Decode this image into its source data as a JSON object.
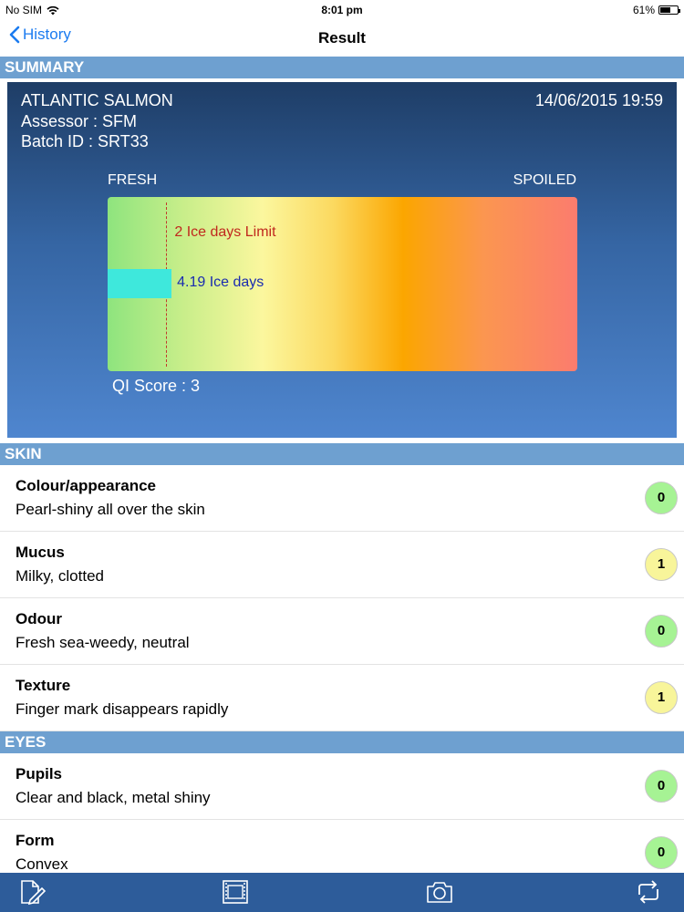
{
  "status_bar": {
    "carrier": "No SIM",
    "time": "8:01 pm",
    "battery": "61%",
    "battery_level": 0.61
  },
  "nav": {
    "back_label": "History",
    "title": "Result"
  },
  "summary": {
    "header": "SUMMARY",
    "species": "ATLANTIC SALMON",
    "datetime": "14/06/2015 19:59",
    "assessor": "Assessor : SFM",
    "batch": "Batch ID : SRT33",
    "fresh_label": "FRESH",
    "spoiled_label": "SPOILED",
    "limit_label": "2 Ice days Limit",
    "days_label": "4.19 Ice days",
    "qi_score": "QI Score : 3",
    "scale_max_ice_days": 16,
    "limit_value": 2,
    "ice_days_value": 4.19
  },
  "sections": [
    {
      "header": "SKIN",
      "rows": [
        {
          "title": "Colour/appearance",
          "value": "Pearl-shiny all over the skin",
          "score": "0",
          "color": "#a6f394"
        },
        {
          "title": "Mucus",
          "value": "Milky, clotted",
          "score": "1",
          "color": "#f8f59a"
        },
        {
          "title": "Odour",
          "value": "Fresh sea-weedy, neutral",
          "score": "0",
          "color": "#a6f394"
        },
        {
          "title": "Texture",
          "value": "Finger mark disappears rapidly",
          "score": "1",
          "color": "#f8f59a"
        }
      ]
    },
    {
      "header": "EYES",
      "rows": [
        {
          "title": "Pupils",
          "value": "Clear and black, metal shiny",
          "score": "0",
          "color": "#a6f394"
        },
        {
          "title": "Form",
          "value": "Convex",
          "score": "0",
          "color": "#a6f394"
        }
      ]
    }
  ],
  "tab_bar": {
    "icons": [
      "edit-document-icon",
      "film-frame-icon",
      "camera-icon",
      "sync-icon"
    ],
    "color": "#2d5c9a"
  }
}
